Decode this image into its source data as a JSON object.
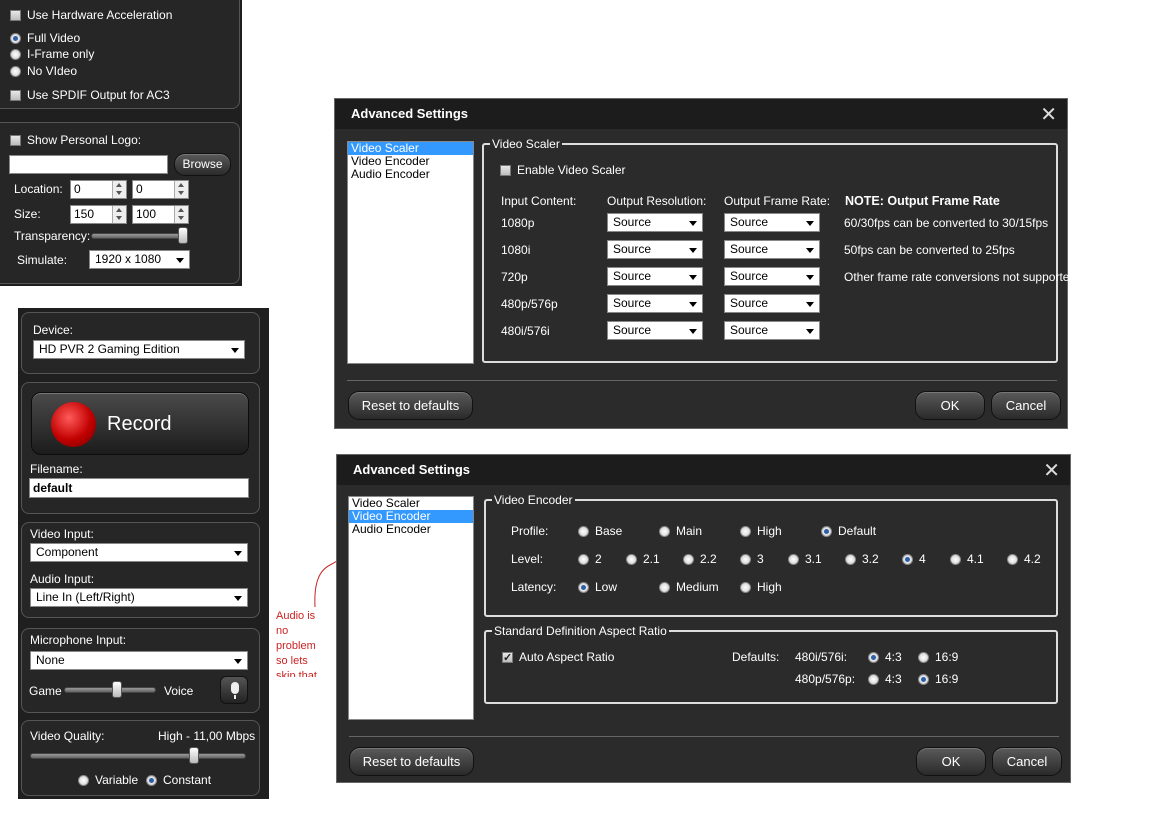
{
  "top_panel": {
    "hw_accel_label": "Use Hardware Acceleration",
    "video_modes": [
      "Full Video",
      "I-Frame only",
      "No VIdeo"
    ],
    "video_mode_selected": 0,
    "spdif_label": "Use SPDIF Output for AC3",
    "logo_label": "Show Personal Logo:",
    "browse_label": "Browse",
    "logo_path": "",
    "location_label": "Location:",
    "location_x": "0",
    "location_y": "0",
    "size_label": "Size:",
    "size_w": "150",
    "size_h": "100",
    "transparency_label": "Transparency:",
    "transparency_level": 1.0,
    "simulate_label": "Simulate:",
    "simulate_value": "1920 x 1080"
  },
  "capture_panel": {
    "device_label": "Device:",
    "device_value": "HD PVR 2 Gaming Edition",
    "record_label": "Record",
    "filename_label": "Filename:",
    "filename_value": "default",
    "video_input_label": "Video Input:",
    "video_input_value": "Component",
    "audio_input_label": "Audio Input:",
    "audio_input_value": "Line In (Left/Right)",
    "mic_input_label": "Microphone Input:",
    "mic_input_value": "None",
    "game_label": "Game",
    "voice_label": "Voice",
    "game_voice_mix": 0.55,
    "quality_label": "Video Quality:",
    "quality_value": "High - 11,00 Mbps",
    "quality_level": 0.8,
    "bitrate_modes": [
      "Variable",
      "Constant"
    ],
    "bitrate_mode_selected": 1
  },
  "annotation": {
    "lines": [
      "Audio is",
      "no",
      "problem",
      "so lets",
      "skip that"
    ],
    "color": "#cc2222"
  },
  "dialog_scaler": {
    "title": "Advanced Settings",
    "nav": [
      "Video Scaler",
      "Video Encoder",
      "Audio Encoder"
    ],
    "nav_selected": 0,
    "group_label": "Video Scaler",
    "enable_label": "Enable Video Scaler",
    "col_input": "Input Content:",
    "col_resolution": "Output Resolution:",
    "col_framerate": "Output Frame Rate:",
    "note_title": "NOTE: Output Frame Rate",
    "note_lines": [
      "60/30fps can be converted to 30/15fps",
      "50fps can be converted to 25fps",
      "Other frame rate conversions not supported"
    ],
    "rows": [
      {
        "input": "1080p",
        "resolution": "Source",
        "framerate": "Source"
      },
      {
        "input": "1080i",
        "resolution": "Source",
        "framerate": "Source"
      },
      {
        "input": "720p",
        "resolution": "Source",
        "framerate": "Source"
      },
      {
        "input": "480p/576p",
        "resolution": "Source",
        "framerate": "Source"
      },
      {
        "input": "480i/576i",
        "resolution": "Source",
        "framerate": "Source"
      }
    ],
    "reset_label": "Reset to defaults",
    "ok_label": "OK",
    "cancel_label": "Cancel"
  },
  "dialog_encoder": {
    "title": "Advanced Settings",
    "nav": [
      "Video Scaler",
      "Video Encoder",
      "Audio Encoder"
    ],
    "nav_selected": 1,
    "group_label": "Video Encoder",
    "profile_label": "Profile:",
    "profiles": [
      "Base",
      "Main",
      "High",
      "Default"
    ],
    "profile_selected": 3,
    "level_label": "Level:",
    "levels": [
      "2",
      "2.1",
      "2.2",
      "3",
      "3.1",
      "3.2",
      "4",
      "4.1",
      "4.2"
    ],
    "level_selected": 6,
    "latency_label": "Latency:",
    "latencies": [
      "Low",
      "Medium",
      "High"
    ],
    "latency_selected": 0,
    "aspect_group_label": "Standard Definition Aspect Ratio",
    "auto_aspect_label": "Auto Aspect Ratio",
    "defaults_label": "Defaults:",
    "aspect_480i_label": "480i/576i:",
    "aspect_480p_label": "480p/576p:",
    "ratio_options": [
      "4:3",
      "16:9"
    ],
    "aspect_480i_selected": 0,
    "aspect_480p_selected": 1,
    "reset_label": "Reset to defaults",
    "ok_label": "OK",
    "cancel_label": "Cancel"
  }
}
